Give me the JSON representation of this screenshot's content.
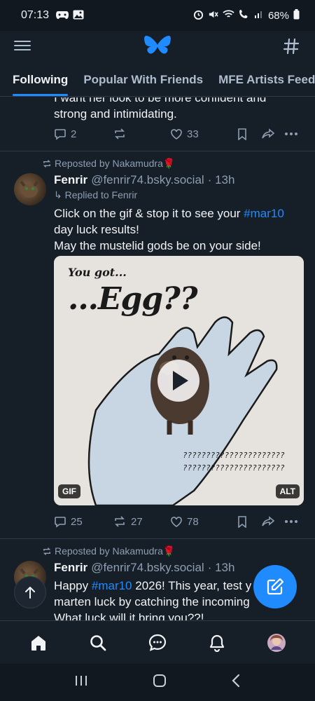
{
  "status_bar": {
    "time": "07:13",
    "battery": "68%"
  },
  "header": {
    "logo": "butterfly-logo",
    "left_icon": "hamburger-icon",
    "right_icon": "hash-icon"
  },
  "tabs": [
    {
      "label": "Following",
      "active": true
    },
    {
      "label": "Popular With Friends",
      "active": false
    },
    {
      "label": "MFE Artists Feed",
      "active": false
    }
  ],
  "post0": {
    "text_line1": "I want her look to be more confident and",
    "text_line2": "strong and intimidating.",
    "replies": "2",
    "reposts": "",
    "likes": "33"
  },
  "post1": {
    "reposted_by": "Reposted by Nakamudra🌹",
    "author_name": "Fenrir",
    "author_handle": "@fenrir74.bsky.social",
    "time": "· 13h",
    "replied_to": "Replied to Fenrir",
    "text_a": "Click on the gif & stop it to see your ",
    "hashtag": "#mar10",
    "text_b": "day luck results!",
    "text_c": "May the mustelid gods be on your side!",
    "media": {
      "caption_top": "You got...",
      "caption_main": "...Egg??",
      "question_line1": "??????????????????????",
      "question_line2": "??????????????????????",
      "badge_left": "GIF",
      "badge_right": "ALT"
    },
    "replies": "25",
    "reposts": "27",
    "likes": "78"
  },
  "post2": {
    "reposted_by": "Reposted by Nakamudra🌹",
    "author_name": "Fenrir",
    "author_handle": "@fenrir74.bsky.social",
    "time": "· 13h",
    "text_a": "Happy ",
    "hashtag": "#mar10",
    "text_b": " 2026! This year, test y",
    "text_c": "marten luck by catching the incoming",
    "text_d": "What luck will it bring you??!"
  },
  "colors": {
    "accent": "#208bfe",
    "background": "#161e27",
    "muted": "#8d9fb3"
  }
}
